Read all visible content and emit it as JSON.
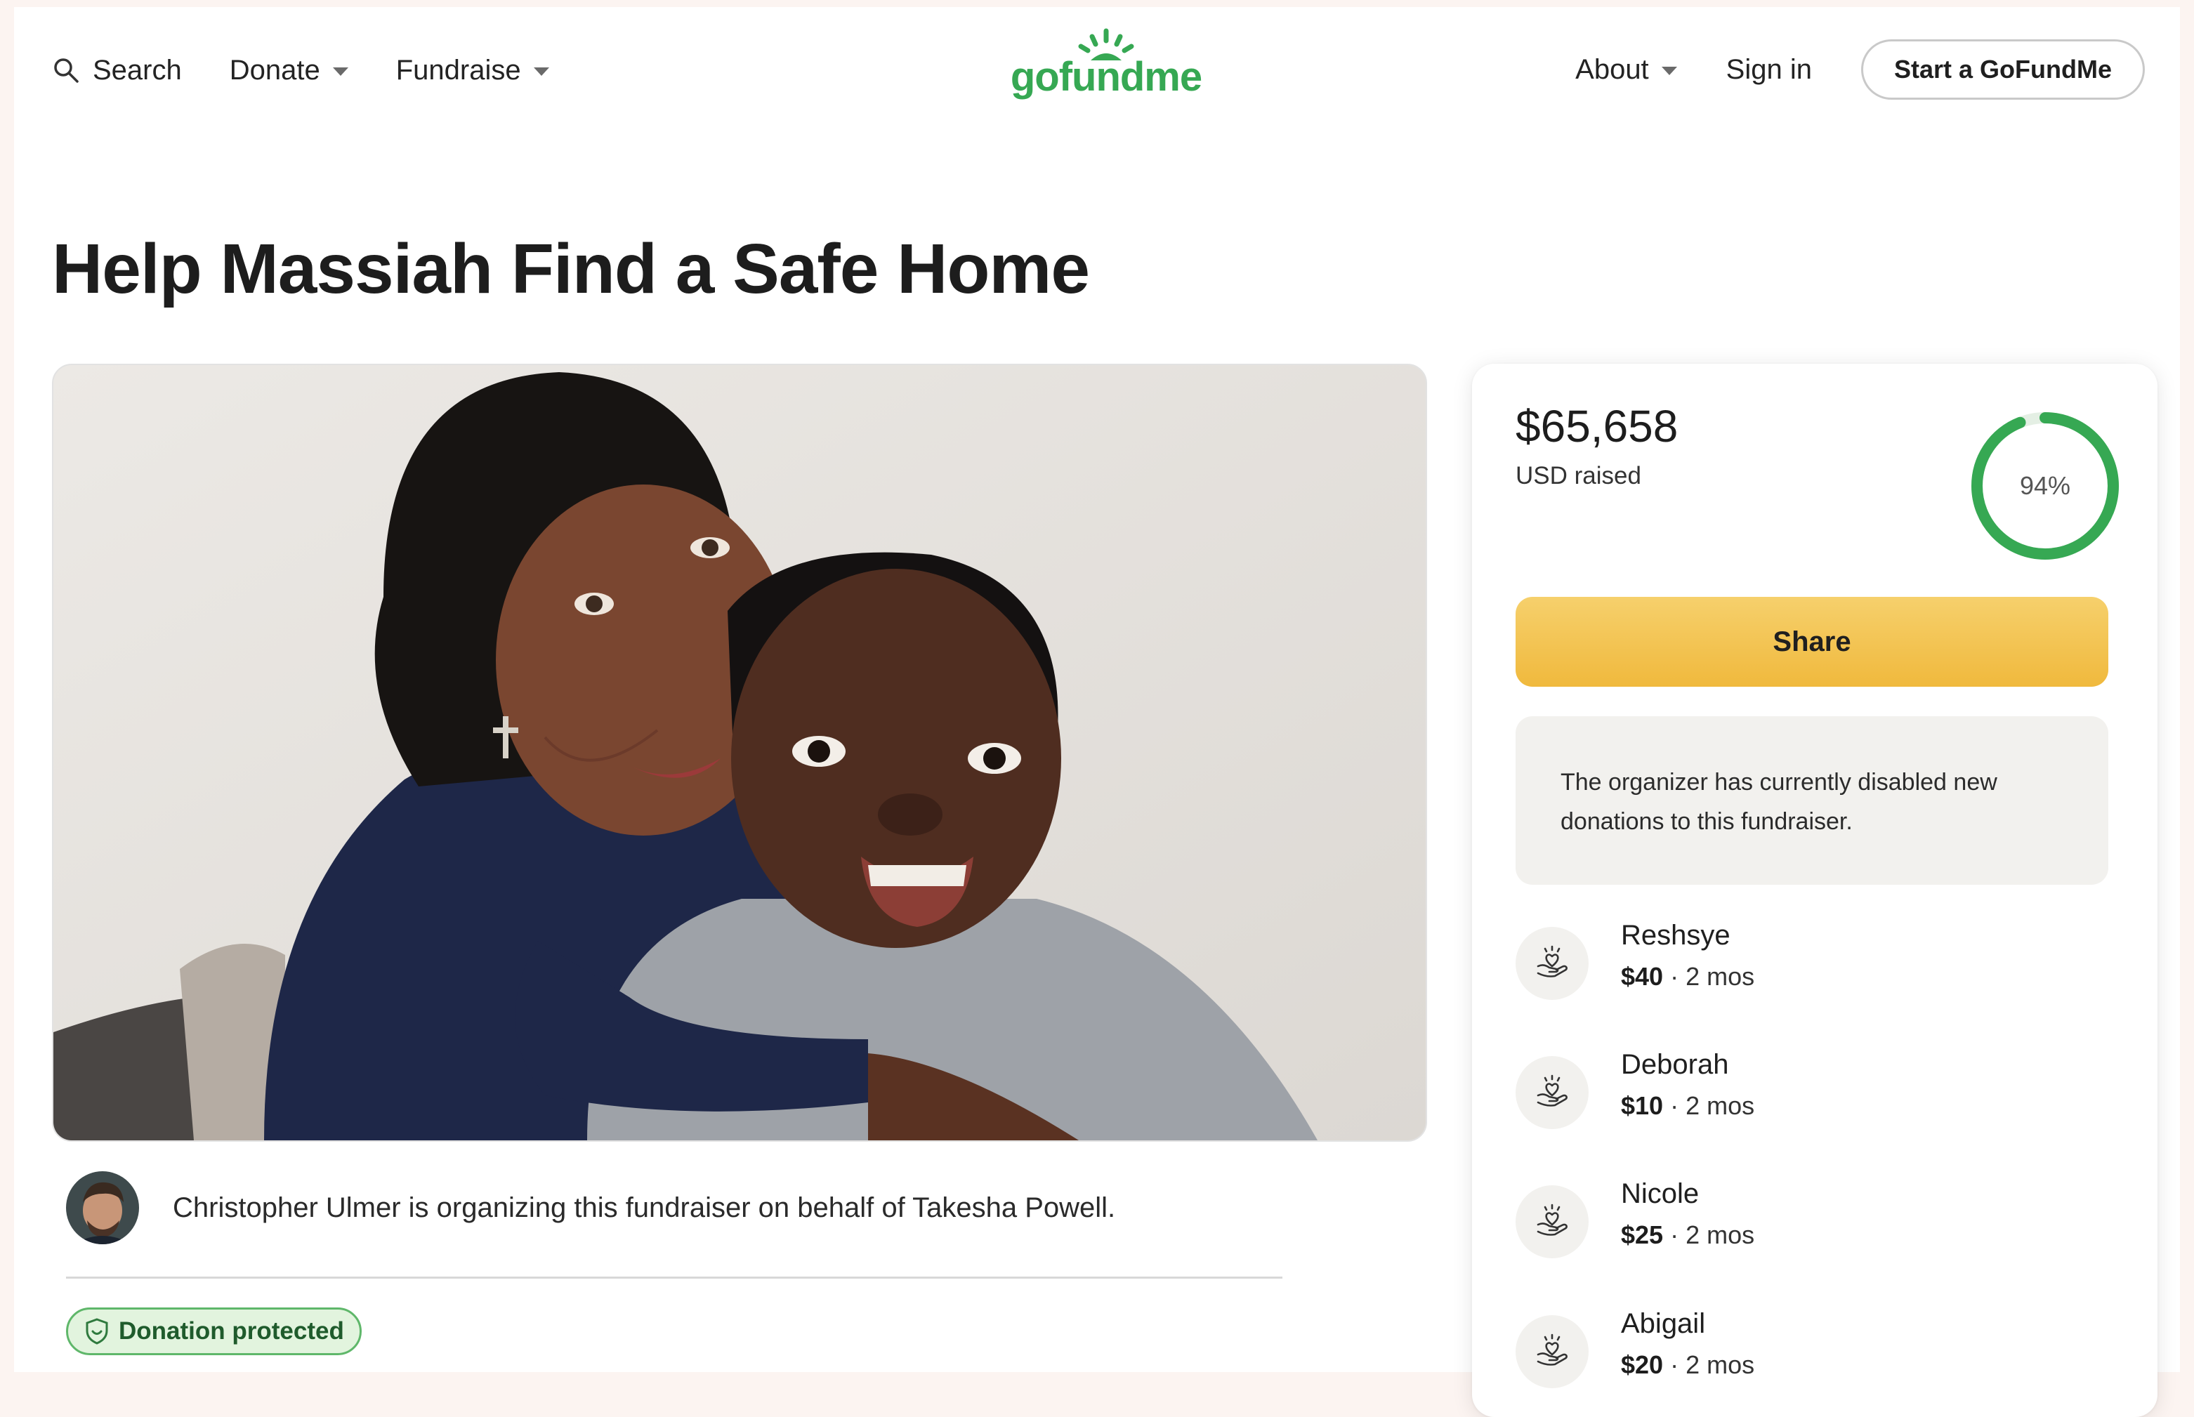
{
  "header": {
    "search_label": "Search",
    "donate_label": "Donate",
    "fundraise_label": "Fundraise",
    "logo_text": "gofundme",
    "about_label": "About",
    "signin_label": "Sign in",
    "start_label": "Start a GoFundMe",
    "brand_color": "#36a853"
  },
  "campaign": {
    "title": "Help Massiah Find a Safe Home",
    "organizer_text": "Christopher Ulmer is organizing this fundraiser on behalf of Takesha Powell.",
    "protected_label": "Donation protected"
  },
  "donation_card": {
    "raised_amount": "$65,658",
    "raised_label": "USD raised",
    "progress_percent": 94,
    "progress_text": "94%",
    "share_label": "Share",
    "notice": "The organizer has currently disabled new donations to this fundraiser.",
    "share_color": "#f0b93d",
    "donors": [
      {
        "name": "Reshsye",
        "amount": "$40",
        "time": "· 2 mos"
      },
      {
        "name": "Deborah",
        "amount": "$10",
        "time": "· 2 mos"
      },
      {
        "name": "Nicole",
        "amount": "$25",
        "time": "· 2 mos"
      },
      {
        "name": "Abigail",
        "amount": "$20",
        "time": "· 2 mos"
      }
    ]
  },
  "icons": {
    "search": "search-icon",
    "caret": "chevron-down-icon",
    "shield": "shield-icon",
    "donor": "heart-hand-icon"
  }
}
